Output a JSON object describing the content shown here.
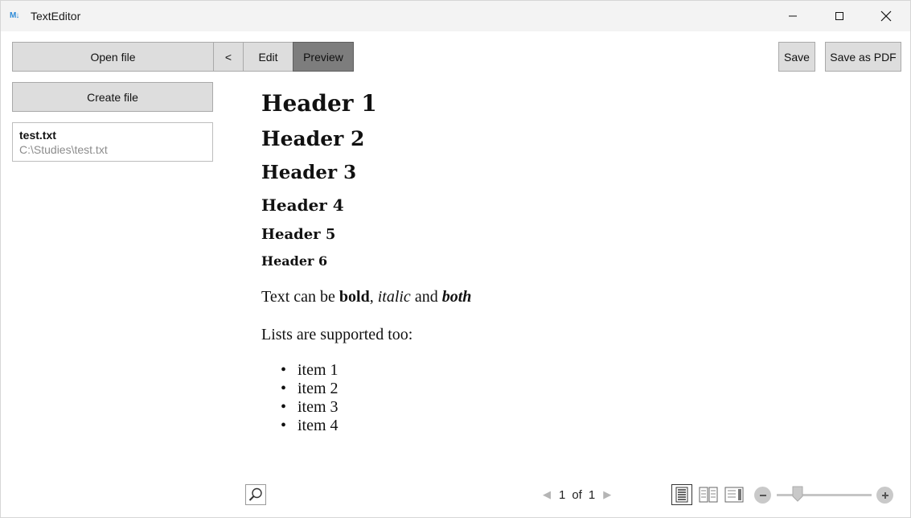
{
  "window": {
    "title": "TextEditor",
    "icon_text": "M↓"
  },
  "toolbar": {
    "open_label": "Open file",
    "back_label": "<",
    "edit_label": "Edit",
    "preview_label": "Preview",
    "save_label": "Save",
    "save_pdf_label": "Save as PDF",
    "active_mode": "Preview"
  },
  "sidebar": {
    "create_label": "Create file",
    "files": [
      {
        "name": "test.txt",
        "path": "C:\\Studies\\test.txt"
      }
    ]
  },
  "preview": {
    "headers": [
      "Header 1",
      "Header 2",
      "Header 3",
      "Header 4",
      "Header 5",
      "Header 6"
    ],
    "paragraph1": {
      "prefix": "Text can be ",
      "bold": "bold",
      "sep": ", ",
      "italic": "italic",
      "and": " and ",
      "both": "both"
    },
    "paragraph2": "Lists are supported too:",
    "list_items": [
      "item 1",
      "item 2",
      "item 3",
      "item 4"
    ]
  },
  "footer": {
    "page_current": "1",
    "page_of": "of",
    "page_total": "1"
  },
  "colors": {
    "button_bg": "#dddddd",
    "button_active_bg": "#7d7d7d",
    "titlebar_bg": "#f3f3f3",
    "path_text": "#8c8c8c",
    "icon_blue": "#2e8bd8"
  },
  "icons": [
    "markdown-app-icon",
    "minimize-icon",
    "maximize-icon",
    "close-icon",
    "search-icon",
    "prev-page-icon",
    "next-page-icon",
    "single-page-view-icon",
    "two-page-view-icon",
    "scroll-view-icon",
    "zoom-out-icon",
    "zoom-in-icon"
  ]
}
